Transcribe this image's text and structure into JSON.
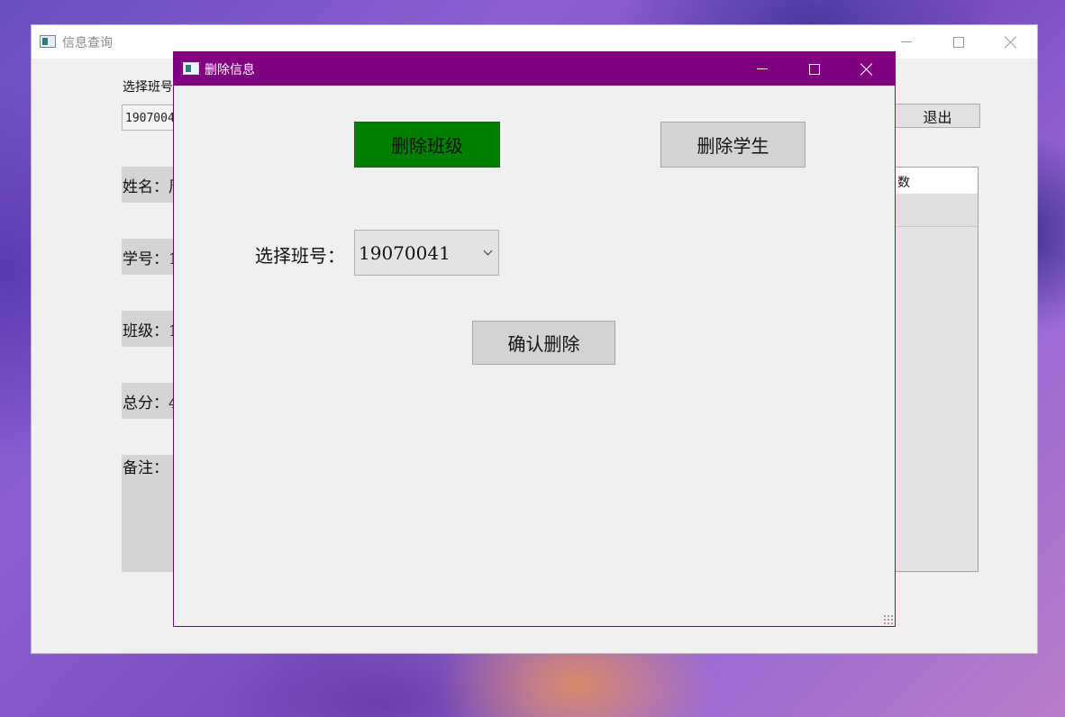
{
  "background_window": {
    "title": "信息查询",
    "select_class_label": "选择班号",
    "class_combo_value": "1907004",
    "fields": {
      "name": "姓名：周",
      "student_id": "学号：1",
      "class": "班级：1",
      "total_score": "总分：4",
      "note": "备注："
    },
    "exit_button": "退出",
    "table_header": "数"
  },
  "dialog": {
    "title": "删除信息",
    "delete_class_button": "删除班级",
    "delete_student_button": "删除学生",
    "select_class_label": "选择班号：",
    "class_combo_value": "19070041",
    "confirm_delete_button": "确认删除",
    "titlebar_color": "#800080",
    "active_button_color": "#008000"
  }
}
